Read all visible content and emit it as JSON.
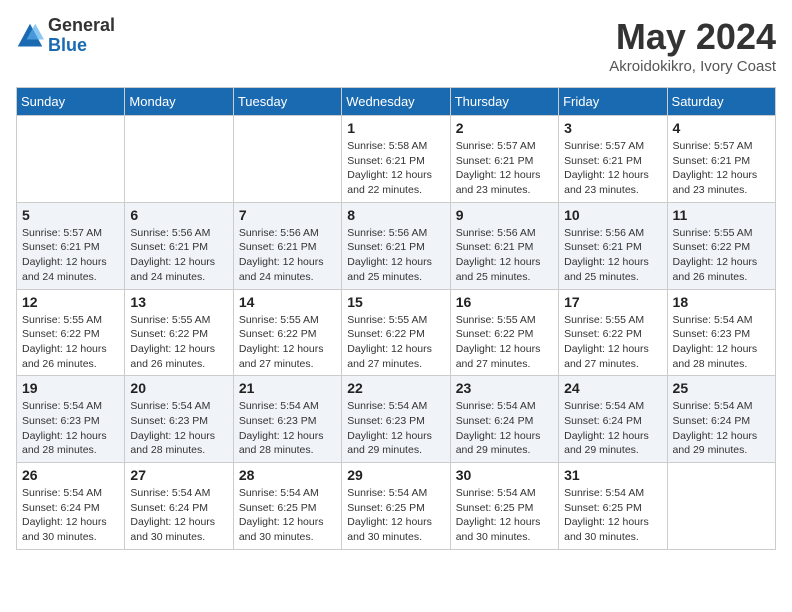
{
  "logo": {
    "general": "General",
    "blue": "Blue"
  },
  "title": {
    "month_year": "May 2024",
    "location": "Akroidokikro, Ivory Coast"
  },
  "weekdays": [
    "Sunday",
    "Monday",
    "Tuesday",
    "Wednesday",
    "Thursday",
    "Friday",
    "Saturday"
  ],
  "weeks": [
    [
      {
        "day": "",
        "text": ""
      },
      {
        "day": "",
        "text": ""
      },
      {
        "day": "",
        "text": ""
      },
      {
        "day": "1",
        "text": "Sunrise: 5:58 AM\nSunset: 6:21 PM\nDaylight: 12 hours\nand 22 minutes."
      },
      {
        "day": "2",
        "text": "Sunrise: 5:57 AM\nSunset: 6:21 PM\nDaylight: 12 hours\nand 23 minutes."
      },
      {
        "day": "3",
        "text": "Sunrise: 5:57 AM\nSunset: 6:21 PM\nDaylight: 12 hours\nand 23 minutes."
      },
      {
        "day": "4",
        "text": "Sunrise: 5:57 AM\nSunset: 6:21 PM\nDaylight: 12 hours\nand 23 minutes."
      }
    ],
    [
      {
        "day": "5",
        "text": "Sunrise: 5:57 AM\nSunset: 6:21 PM\nDaylight: 12 hours\nand 24 minutes."
      },
      {
        "day": "6",
        "text": "Sunrise: 5:56 AM\nSunset: 6:21 PM\nDaylight: 12 hours\nand 24 minutes."
      },
      {
        "day": "7",
        "text": "Sunrise: 5:56 AM\nSunset: 6:21 PM\nDaylight: 12 hours\nand 24 minutes."
      },
      {
        "day": "8",
        "text": "Sunrise: 5:56 AM\nSunset: 6:21 PM\nDaylight: 12 hours\nand 25 minutes."
      },
      {
        "day": "9",
        "text": "Sunrise: 5:56 AM\nSunset: 6:21 PM\nDaylight: 12 hours\nand 25 minutes."
      },
      {
        "day": "10",
        "text": "Sunrise: 5:56 AM\nSunset: 6:21 PM\nDaylight: 12 hours\nand 25 minutes."
      },
      {
        "day": "11",
        "text": "Sunrise: 5:55 AM\nSunset: 6:22 PM\nDaylight: 12 hours\nand 26 minutes."
      }
    ],
    [
      {
        "day": "12",
        "text": "Sunrise: 5:55 AM\nSunset: 6:22 PM\nDaylight: 12 hours\nand 26 minutes."
      },
      {
        "day": "13",
        "text": "Sunrise: 5:55 AM\nSunset: 6:22 PM\nDaylight: 12 hours\nand 26 minutes."
      },
      {
        "day": "14",
        "text": "Sunrise: 5:55 AM\nSunset: 6:22 PM\nDaylight: 12 hours\nand 27 minutes."
      },
      {
        "day": "15",
        "text": "Sunrise: 5:55 AM\nSunset: 6:22 PM\nDaylight: 12 hours\nand 27 minutes."
      },
      {
        "day": "16",
        "text": "Sunrise: 5:55 AM\nSunset: 6:22 PM\nDaylight: 12 hours\nand 27 minutes."
      },
      {
        "day": "17",
        "text": "Sunrise: 5:55 AM\nSunset: 6:22 PM\nDaylight: 12 hours\nand 27 minutes."
      },
      {
        "day": "18",
        "text": "Sunrise: 5:54 AM\nSunset: 6:23 PM\nDaylight: 12 hours\nand 28 minutes."
      }
    ],
    [
      {
        "day": "19",
        "text": "Sunrise: 5:54 AM\nSunset: 6:23 PM\nDaylight: 12 hours\nand 28 minutes."
      },
      {
        "day": "20",
        "text": "Sunrise: 5:54 AM\nSunset: 6:23 PM\nDaylight: 12 hours\nand 28 minutes."
      },
      {
        "day": "21",
        "text": "Sunrise: 5:54 AM\nSunset: 6:23 PM\nDaylight: 12 hours\nand 28 minutes."
      },
      {
        "day": "22",
        "text": "Sunrise: 5:54 AM\nSunset: 6:23 PM\nDaylight: 12 hours\nand 29 minutes."
      },
      {
        "day": "23",
        "text": "Sunrise: 5:54 AM\nSunset: 6:24 PM\nDaylight: 12 hours\nand 29 minutes."
      },
      {
        "day": "24",
        "text": "Sunrise: 5:54 AM\nSunset: 6:24 PM\nDaylight: 12 hours\nand 29 minutes."
      },
      {
        "day": "25",
        "text": "Sunrise: 5:54 AM\nSunset: 6:24 PM\nDaylight: 12 hours\nand 29 minutes."
      }
    ],
    [
      {
        "day": "26",
        "text": "Sunrise: 5:54 AM\nSunset: 6:24 PM\nDaylight: 12 hours\nand 30 minutes."
      },
      {
        "day": "27",
        "text": "Sunrise: 5:54 AM\nSunset: 6:24 PM\nDaylight: 12 hours\nand 30 minutes."
      },
      {
        "day": "28",
        "text": "Sunrise: 5:54 AM\nSunset: 6:25 PM\nDaylight: 12 hours\nand 30 minutes."
      },
      {
        "day": "29",
        "text": "Sunrise: 5:54 AM\nSunset: 6:25 PM\nDaylight: 12 hours\nand 30 minutes."
      },
      {
        "day": "30",
        "text": "Sunrise: 5:54 AM\nSunset: 6:25 PM\nDaylight: 12 hours\nand 30 minutes."
      },
      {
        "day": "31",
        "text": "Sunrise: 5:54 AM\nSunset: 6:25 PM\nDaylight: 12 hours\nand 30 minutes."
      },
      {
        "day": "",
        "text": ""
      }
    ]
  ]
}
